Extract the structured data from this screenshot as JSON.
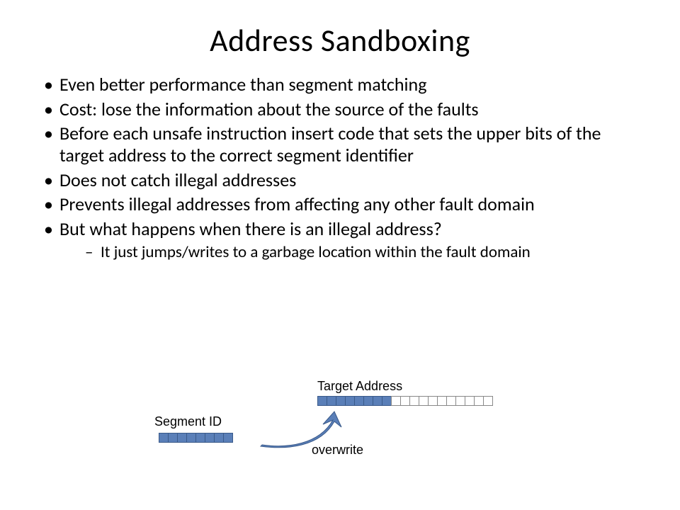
{
  "title": "Address Sandboxing",
  "bullets": [
    "Even better performance than segment matching",
    "Cost: lose the information about the source of the faults",
    "Before each unsafe instruction insert code that sets the upper bits of the target address to the correct segment identifier",
    "Does not catch illegal addresses",
    "Prevents illegal addresses from affecting any other fault domain",
    "But what happens when there is an illegal address?"
  ],
  "sub_bullet": "It just jumps/writes to a garbage location within the fault domain",
  "diagram": {
    "segment_id_label": "Segment ID",
    "target_address_label": "Target Address",
    "overwrite_label": "overwrite",
    "segment_bits": 8,
    "target_total_bits": 19,
    "target_upper_bits": 8,
    "colors": {
      "filled": "#5a7fb8",
      "border": "#3a5a8a",
      "empty_border": "#888"
    }
  }
}
